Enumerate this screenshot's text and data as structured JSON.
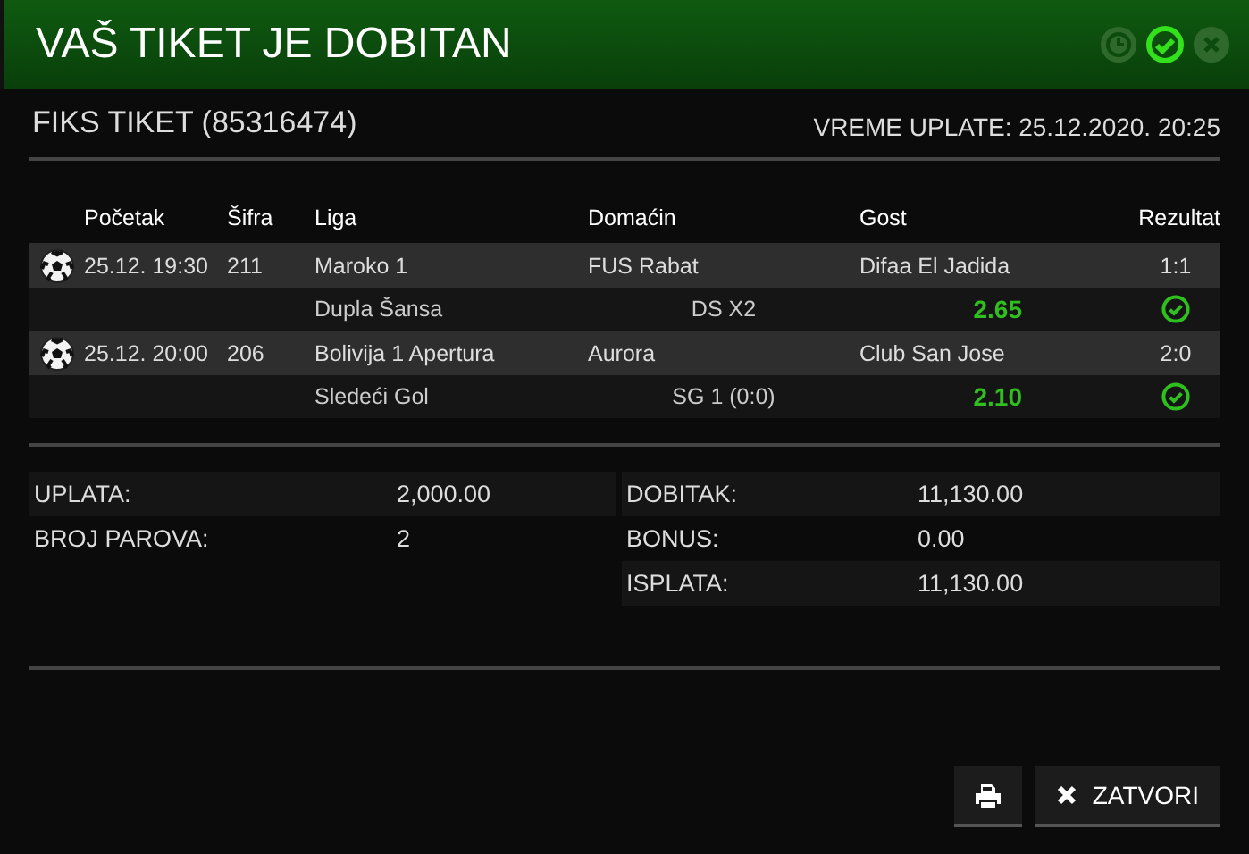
{
  "window": {
    "title": "VAŠ TIKET JE DOBITAN"
  },
  "status_icons": [
    {
      "kind": "pending",
      "active": false
    },
    {
      "kind": "won",
      "active": true
    },
    {
      "kind": "lost",
      "active": false
    }
  ],
  "ticket": {
    "name": "FIKS TIKET (85316474)",
    "paid_time": "VREME UPLATE: 25.12.2020. 20:25"
  },
  "table": {
    "columns": [
      "Početak",
      "Šifra",
      "Liga",
      "Domaćin",
      "Gost",
      "Rezultat"
    ],
    "rows": [
      {
        "start": "25.12. 19:30",
        "code": "211",
        "league": "Maroko 1",
        "home": "FUS Rabat",
        "away": "Difaa El Jadida",
        "result": "1:1",
        "bet_type": "Dupla Šansa",
        "pick": "DS X2",
        "odds": "2.65",
        "won": true
      },
      {
        "start": "25.12. 20:00",
        "code": "206",
        "league": "Bolivija 1 Apertura",
        "home": "Aurora",
        "away": "Club San Jose",
        "result": "2:0",
        "bet_type": "Sledeći Gol",
        "pick": "SG 1 (0:0)",
        "odds": "2.10",
        "won": true
      }
    ]
  },
  "summary": {
    "left": [
      {
        "label": "UPLATA:",
        "value": "2,000.00"
      },
      {
        "label": "BROJ PAROVA:",
        "value": "2"
      }
    ],
    "right": [
      {
        "label": "DOBITAK:",
        "value": "11,130.00"
      },
      {
        "label": "BONUS:",
        "value": "0.00"
      },
      {
        "label": "ISPLATA:",
        "value": "11,130.00"
      }
    ]
  },
  "buttons": [
    {
      "kind": "print"
    },
    {
      "kind": "close",
      "label": "ZATVORI"
    }
  ]
}
